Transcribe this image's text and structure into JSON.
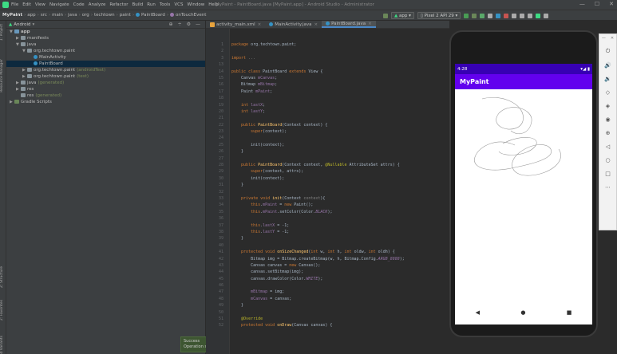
{
  "window": {
    "title": "MyPaint - PaintBoard.java [MyPaint.app] - Android Studio - Administrator",
    "menu": [
      "File",
      "Edit",
      "View",
      "Navigate",
      "Code",
      "Analyze",
      "Refactor",
      "Build",
      "Run",
      "Tools",
      "VCS",
      "Window",
      "Help"
    ],
    "controls": [
      "—",
      "☐",
      "✕"
    ]
  },
  "breadcrumb": [
    "MyPaint",
    "app",
    "src",
    "main",
    "java",
    "org",
    "techtown",
    "paint",
    "PaintBoard",
    "onTouchEvent"
  ],
  "toolbar": {
    "run_config": "app",
    "device": "Pixel 2 API 29"
  },
  "side_tabs": {
    "left_top": [
      "1: Project",
      "Resource Manager"
    ],
    "left_bottom": [
      "Z: Structure",
      "2: Favorites",
      "Build Variants"
    ]
  },
  "project": {
    "view_selector": "Android",
    "tree": [
      {
        "label": "app",
        "level": 0,
        "arrow": "▼",
        "icon": "folder-blue",
        "bold": true
      },
      {
        "label": "manifests",
        "level": 1,
        "arrow": "▶",
        "icon": "folder"
      },
      {
        "label": "java",
        "level": 1,
        "arrow": "▼",
        "icon": "folder"
      },
      {
        "label": "org.techtown.paint",
        "level": 2,
        "arrow": "▼",
        "icon": "folder"
      },
      {
        "label": "MainActivity",
        "level": 3,
        "arrow": "",
        "icon": "class"
      },
      {
        "label": "PaintBoard",
        "level": 3,
        "arrow": "",
        "icon": "class",
        "selected": true
      },
      {
        "label": "org.techtown.paint",
        "suffix": "(androidTest)",
        "level": 2,
        "arrow": "▶",
        "icon": "folder"
      },
      {
        "label": "org.techtown.paint",
        "suffix": "(test)",
        "level": 2,
        "arrow": "▶",
        "icon": "folder"
      },
      {
        "label": "java",
        "suffix": "(generated)",
        "level": 1,
        "arrow": "▶",
        "icon": "folder"
      },
      {
        "label": "res",
        "level": 1,
        "arrow": "▶",
        "icon": "folder"
      },
      {
        "label": "res",
        "suffix": "(generated)",
        "level": 1,
        "arrow": "",
        "icon": "folder"
      },
      {
        "label": "Gradle Scripts",
        "level": 0,
        "arrow": "▶",
        "icon": "gradle"
      }
    ]
  },
  "toast": {
    "title": "Success",
    "message": "Operation succeeded"
  },
  "tabs": [
    {
      "label": "activity_main.xml",
      "active": false
    },
    {
      "label": "MainActivity.java",
      "active": false
    },
    {
      "label": "PaintBoard.java",
      "active": true
    }
  ],
  "code": [
    {
      "n": "1",
      "parts": [
        [
          "kw",
          "package "
        ],
        [
          "pl",
          "org.techtown.paint;"
        ]
      ]
    },
    {
      "n": "2",
      "parts": []
    },
    {
      "n": "3",
      "parts": [
        [
          "kw",
          "import "
        ],
        [
          "cm",
          "..."
        ]
      ]
    },
    {
      "n": "13",
      "parts": []
    },
    {
      "n": "14",
      "parts": [
        [
          "kw",
          "public class "
        ],
        [
          "pl",
          "PaintBoard "
        ],
        [
          "kw",
          "extends "
        ],
        [
          "pl",
          "View {"
        ]
      ]
    },
    {
      "n": "15",
      "parts": [
        [
          "pl",
          "    Canvas "
        ],
        [
          "fd",
          "mCanvas"
        ],
        [
          "pl",
          ";"
        ]
      ]
    },
    {
      "n": "16",
      "parts": [
        [
          "pl",
          "    Bitmap "
        ],
        [
          "fd",
          "mBitmap"
        ],
        [
          "pl",
          ";"
        ]
      ]
    },
    {
      "n": "17",
      "parts": [
        [
          "pl",
          "    Paint "
        ],
        [
          "fd",
          "mPaint"
        ],
        [
          "pl",
          ";"
        ]
      ]
    },
    {
      "n": "18",
      "parts": []
    },
    {
      "n": "19",
      "parts": [
        [
          "kw",
          "    int "
        ],
        [
          "fd",
          "lastX"
        ],
        [
          "pl",
          ";"
        ]
      ]
    },
    {
      "n": "20",
      "parts": [
        [
          "kw",
          "    int "
        ],
        [
          "fd",
          "lastY"
        ],
        [
          "pl",
          ";"
        ]
      ]
    },
    {
      "n": "21",
      "parts": []
    },
    {
      "n": "22",
      "parts": [
        [
          "kw",
          "    public "
        ],
        [
          "fn",
          "PaintBoard"
        ],
        [
          "pl",
          "(Context context) {"
        ]
      ]
    },
    {
      "n": "23",
      "parts": [
        [
          "kw",
          "        super"
        ],
        [
          "pl",
          "(context);"
        ]
      ]
    },
    {
      "n": "24",
      "parts": []
    },
    {
      "n": "25",
      "parts": [
        [
          "pl",
          "        init(context);"
        ]
      ]
    },
    {
      "n": "26",
      "parts": [
        [
          "pl",
          "    }"
        ]
      ]
    },
    {
      "n": "27",
      "parts": []
    },
    {
      "n": "28",
      "parts": [
        [
          "kw",
          "    public "
        ],
        [
          "fn",
          "PaintBoard"
        ],
        [
          "pl",
          "(Context context, "
        ],
        [
          "an",
          "@Nullable "
        ],
        [
          "pl",
          "AttributeSet attrs) {"
        ]
      ]
    },
    {
      "n": "29",
      "parts": [
        [
          "kw",
          "        super"
        ],
        [
          "pl",
          "(context, attrs);"
        ]
      ]
    },
    {
      "n": "30",
      "parts": [
        [
          "pl",
          "        init(context);"
        ]
      ]
    },
    {
      "n": "31",
      "parts": [
        [
          "pl",
          "    }"
        ]
      ]
    },
    {
      "n": "32",
      "parts": []
    },
    {
      "n": "33",
      "parts": [
        [
          "kw",
          "    private void "
        ],
        [
          "fn",
          "init"
        ],
        [
          "pl",
          "(Context "
        ],
        [
          "cm",
          "context"
        ],
        [
          "pl",
          "){"
        ]
      ]
    },
    {
      "n": "34",
      "parts": [
        [
          "kw",
          "        this"
        ],
        [
          "pl",
          "."
        ],
        [
          "fd",
          "mPaint"
        ],
        [
          "pl",
          " = "
        ],
        [
          "kw",
          "new "
        ],
        [
          "pl",
          "Paint();"
        ]
      ]
    },
    {
      "n": "35",
      "parts": [
        [
          "kw",
          "        this"
        ],
        [
          "pl",
          "."
        ],
        [
          "fd",
          "mPaint"
        ],
        [
          "pl",
          ".setColor(Color."
        ],
        [
          "cst",
          "BLACK"
        ],
        [
          "pl",
          ");"
        ]
      ]
    },
    {
      "n": "36",
      "parts": []
    },
    {
      "n": "37",
      "parts": [
        [
          "kw",
          "        this"
        ],
        [
          "pl",
          "."
        ],
        [
          "fd",
          "lastX"
        ],
        [
          "pl",
          " = -1;"
        ]
      ]
    },
    {
      "n": "38",
      "parts": [
        [
          "kw",
          "        this"
        ],
        [
          "pl",
          "."
        ],
        [
          "fd",
          "lastY"
        ],
        [
          "pl",
          " = -1;"
        ]
      ]
    },
    {
      "n": "39",
      "parts": [
        [
          "pl",
          "    }"
        ]
      ]
    },
    {
      "n": "40",
      "parts": []
    },
    {
      "n": "41",
      "parts": [
        [
          "kw",
          "    protected void "
        ],
        [
          "fn",
          "onSizeChanged"
        ],
        [
          "pl",
          "("
        ],
        [
          "kw",
          "int "
        ],
        [
          "pl",
          "w, "
        ],
        [
          "kw",
          "int "
        ],
        [
          "pl",
          "h, "
        ],
        [
          "kw",
          "int "
        ],
        [
          "pl",
          "oldw, "
        ],
        [
          "kw",
          "int "
        ],
        [
          "pl",
          "oldh) {"
        ]
      ]
    },
    {
      "n": "42",
      "parts": [
        [
          "pl",
          "        Bitmap img = Bitmap.createBitmap(w, h, Bitmap.Config."
        ],
        [
          "cst",
          "ARGB_8888"
        ],
        [
          "pl",
          ");"
        ]
      ]
    },
    {
      "n": "43",
      "parts": [
        [
          "pl",
          "        Canvas canvas = "
        ],
        [
          "kw",
          "new "
        ],
        [
          "pl",
          "Canvas();"
        ]
      ]
    },
    {
      "n": "44",
      "parts": [
        [
          "pl",
          "        canvas.setBitmap(img);"
        ]
      ]
    },
    {
      "n": "45",
      "parts": [
        [
          "pl",
          "        canvas.drawColor(Color."
        ],
        [
          "cst",
          "WHITE"
        ],
        [
          "pl",
          ");"
        ]
      ]
    },
    {
      "n": "46",
      "parts": []
    },
    {
      "n": "47",
      "parts": [
        [
          "pl",
          "        "
        ],
        [
          "fd",
          "mBitmap"
        ],
        [
          "pl",
          " = img;"
        ]
      ]
    },
    {
      "n": "48",
      "parts": [
        [
          "pl",
          "        "
        ],
        [
          "fd",
          "mCanvas"
        ],
        [
          "pl",
          " = canvas;"
        ]
      ]
    },
    {
      "n": "49",
      "parts": [
        [
          "pl",
          "    }"
        ]
      ]
    },
    {
      "n": "50",
      "parts": []
    },
    {
      "n": "51",
      "parts": [
        [
          "an",
          "    @Override"
        ]
      ]
    },
    {
      "n": "52",
      "parts": [
        [
          "kw",
          "    protected void "
        ],
        [
          "fn",
          "onDraw"
        ],
        [
          "pl",
          "(Canvas canvas) {"
        ]
      ]
    }
  ],
  "emulator": {
    "time": "4:28",
    "app_title": "MyPaint",
    "nav_buttons": [
      "◀",
      "●",
      "■"
    ],
    "side_controls": [
      "✕"
    ]
  }
}
